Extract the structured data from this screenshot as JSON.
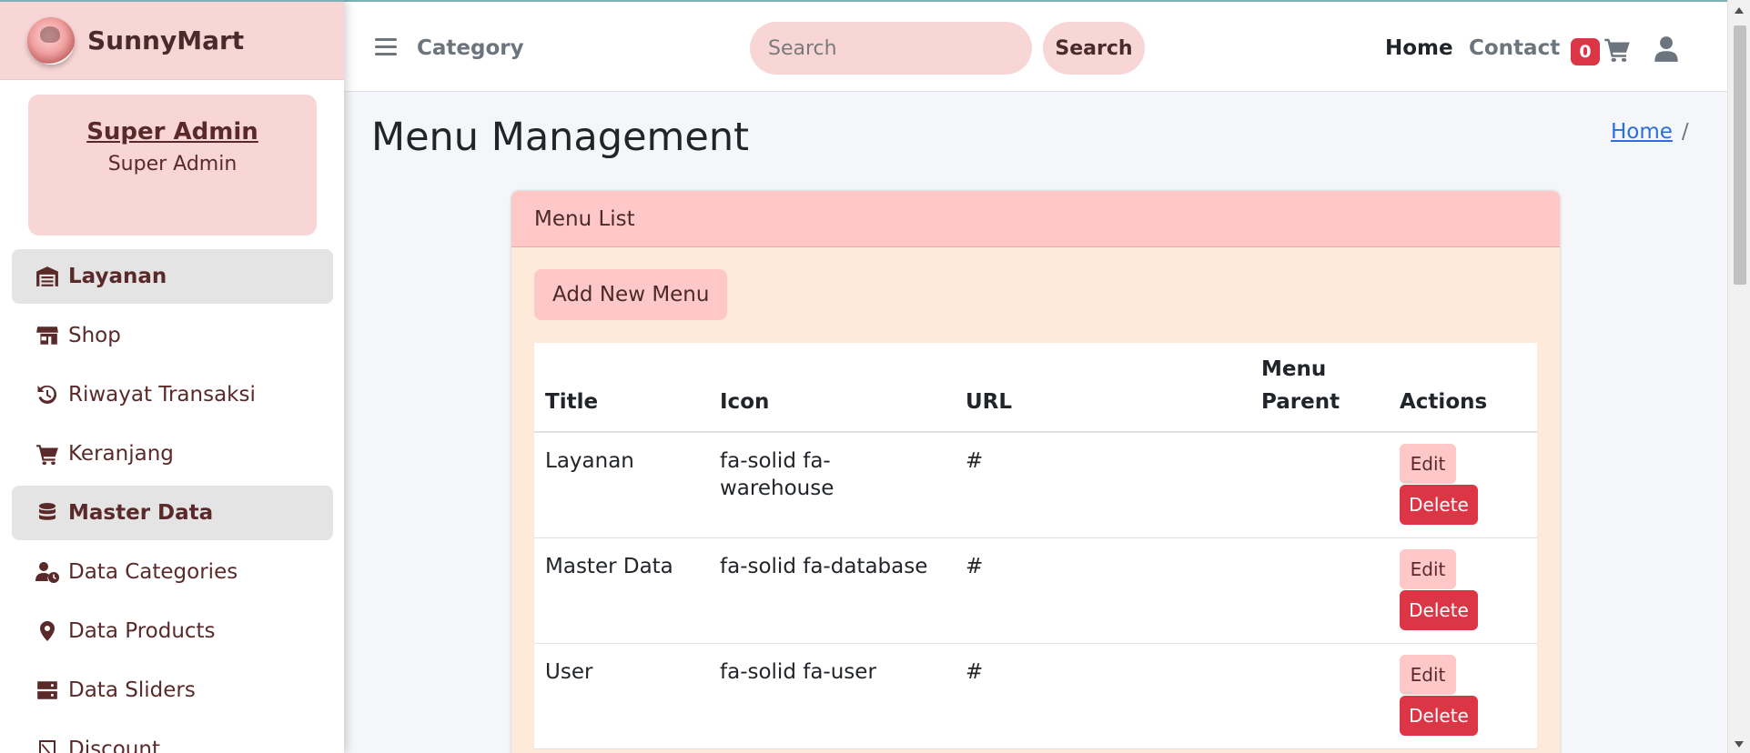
{
  "brand": {
    "name": "SunnyMart"
  },
  "user": {
    "name": "Super Admin",
    "role": "Super Admin"
  },
  "sidebar": {
    "items": [
      {
        "label": "Layanan",
        "icon": "warehouse-icon",
        "header": true
      },
      {
        "label": "Shop",
        "icon": "shop-icon",
        "header": false
      },
      {
        "label": "Riwayat Transaksi",
        "icon": "history-icon",
        "header": false
      },
      {
        "label": "Keranjang",
        "icon": "cart-icon",
        "header": false
      },
      {
        "label": "Master Data",
        "icon": "database-icon",
        "header": true
      },
      {
        "label": "Data Categories",
        "icon": "user-clock-icon",
        "header": false
      },
      {
        "label": "Data Products",
        "icon": "location-pin-icon",
        "header": false
      },
      {
        "label": "Data Sliders",
        "icon": "server-icon",
        "header": false
      },
      {
        "label": "Discount",
        "icon": "discount-icon",
        "header": false
      }
    ]
  },
  "topbar": {
    "category": "Category",
    "search_placeholder": "Search",
    "search_button": "Search",
    "home": "Home",
    "contact": "Contact",
    "cart_count": "0"
  },
  "page": {
    "title": "Menu Management",
    "breadcrumb_home": "Home",
    "breadcrumb_sep": "/"
  },
  "card": {
    "header": "Menu List",
    "add_button": "Add New Menu"
  },
  "table": {
    "headers": {
      "title": "Title",
      "icon": "Icon",
      "url": "URL",
      "parent_1": "Menu",
      "parent_2": "Parent",
      "actions": "Actions"
    },
    "edit_label": "Edit",
    "delete_label": "Delete",
    "rows": [
      {
        "title": "Layanan",
        "icon": "fa-solid fa-warehouse",
        "url": "#",
        "parent": ""
      },
      {
        "title": "Master Data",
        "icon": "fa-solid fa-database",
        "url": "#",
        "parent": ""
      },
      {
        "title": "User",
        "icon": "fa-solid fa-user",
        "url": "#",
        "parent": ""
      }
    ]
  },
  "colors": {
    "brand_pink": "#f8d6d6",
    "card_header": "#ffc8c8",
    "card_body": "#ffe9d9",
    "danger": "#dc3545",
    "link": "#2a6fdb",
    "sidebar_text": "#5a2a2a"
  }
}
